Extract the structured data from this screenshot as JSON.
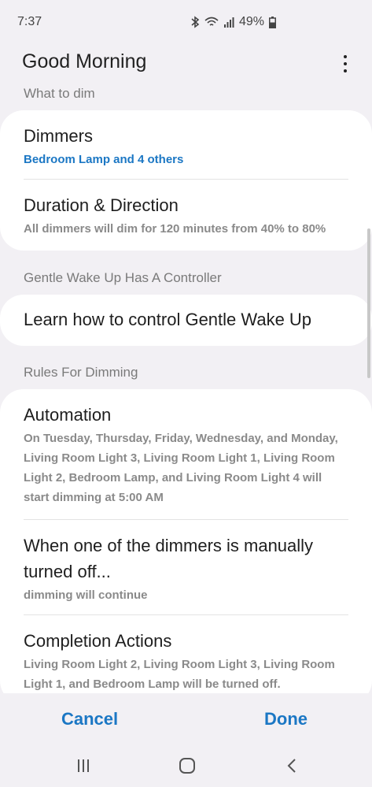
{
  "status_bar": {
    "time": "7:37",
    "battery": "49%"
  },
  "header": {
    "title": "Good Morning"
  },
  "sections": {
    "what_to_dim": "What to dim",
    "controller": "Gentle Wake Up Has A Controller",
    "rules": "Rules For Dimming"
  },
  "dimmers": {
    "title": "Dimmers",
    "subtitle": "Bedroom Lamp and 4 others"
  },
  "duration": {
    "title": "Duration & Direction",
    "subtitle": "All dimmers will dim for 120 minutes from 40% to 80%"
  },
  "learn": {
    "title": "Learn how to control Gentle Wake Up"
  },
  "automation": {
    "title": "Automation",
    "subtitle_lines": [
      "On Tuesday, Thursday, Friday, Wednesday, and Monday,",
      "Living Room Light 3, Living Room Light 1, Living Room",
      "Light 2, Bedroom Lamp, and Living Room Light 4 will",
      "start dimming at 5:00 AM"
    ]
  },
  "manual_off": {
    "title_lines": [
      "When one of the dimmers is manually",
      "turned off..."
    ],
    "subtitle": "dimming will continue"
  },
  "completion": {
    "title": "Completion Actions",
    "subtitle_lines": [
      "Living Room Light 2, Living Room Light 3, Living Room",
      "Light 1, and Bedroom Lamp will be turned off."
    ]
  },
  "actions": {
    "cancel": "Cancel",
    "done": "Done"
  },
  "icons": {
    "bluetooth": "bluetooth-icon",
    "wifi": "wifi-icon",
    "signal": "signal-icon",
    "battery": "battery-icon",
    "more": "more-vert-icon",
    "recents": "recents-icon",
    "home": "home-icon",
    "back": "back-icon"
  },
  "colors": {
    "accent": "#1b77c4",
    "background": "#f2f0f4",
    "card": "#ffffff"
  }
}
